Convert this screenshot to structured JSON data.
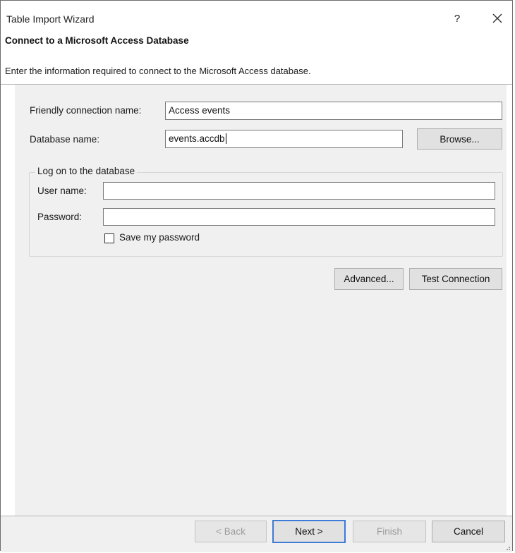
{
  "window": {
    "title": "Table Import Wizard",
    "help_label": "?"
  },
  "header": {
    "title": "Connect to a Microsoft Access Database",
    "description": "Enter the information required to connect to the Microsoft Access database."
  },
  "form": {
    "friendly_name_label": "Friendly connection name:",
    "friendly_name_value": "Access events",
    "database_name_label": "Database name:",
    "database_name_value": "events.accdb",
    "browse_label": "Browse..."
  },
  "logon": {
    "group_label": "Log on to the database",
    "user_name_label": "User name:",
    "user_name_value": "",
    "password_label": "Password:",
    "password_value": "",
    "save_password_label": "Save my password",
    "save_password_checked": false
  },
  "actions": {
    "advanced_label": "Advanced...",
    "test_connection_label": "Test Connection"
  },
  "footer": {
    "back_label": "< Back",
    "next_label": "Next >",
    "finish_label": "Finish",
    "cancel_label": "Cancel"
  }
}
